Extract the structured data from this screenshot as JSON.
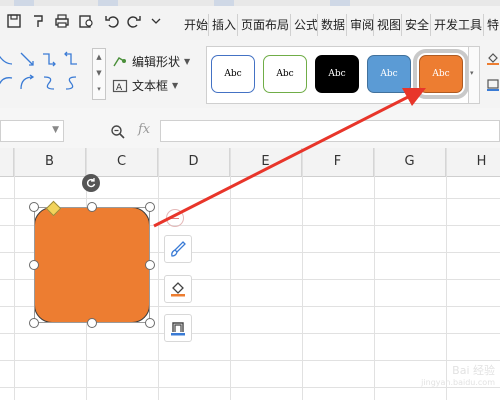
{
  "tabs": [
    "开始",
    "插入",
    "页面布局",
    "公式",
    "数据",
    "审阅",
    "视图",
    "安全",
    "开发工具",
    "特"
  ],
  "ribbon": {
    "edit_shape_label": "编辑形状",
    "text_box_label": "文本框",
    "style_gallery": [
      {
        "label": "Abc",
        "fill": "#FFFFFF",
        "border": "#4472C4",
        "text_color": "#000000"
      },
      {
        "label": "Abc",
        "fill": "#FFFFFF",
        "border": "#70AD47",
        "text_color": "#000000"
      },
      {
        "label": "Abc",
        "fill": "#000000",
        "border": "#000000",
        "text_color": "#FFFFFF"
      },
      {
        "label": "Abc",
        "fill": "#5B9BD5",
        "border": "#41719C",
        "text_color": "#FFFFFF"
      },
      {
        "label": "Abc",
        "fill": "#ED7D31",
        "border": "#AE5A21",
        "text_color": "#FFFFFF",
        "selected": true
      }
    ]
  },
  "formula_bar": {
    "fx_label": "fx",
    "name_box_value": "",
    "formula_value": ""
  },
  "columns": [
    "B",
    "C",
    "D",
    "E",
    "F",
    "G",
    "H"
  ],
  "shape": {
    "type": "rounded-rectangle",
    "fill": "#ED7D31",
    "border": "#3B3B3B"
  },
  "annotation": {
    "arrow_color": "#E8352A"
  },
  "watermark": {
    "text": "Bai 经验",
    "sub": "jingyan.baidu.com"
  },
  "colors": {
    "accent": "#ED7D31",
    "ribbon_bg": "#F4F4F4",
    "tab_bg": "#F3F3F3"
  }
}
